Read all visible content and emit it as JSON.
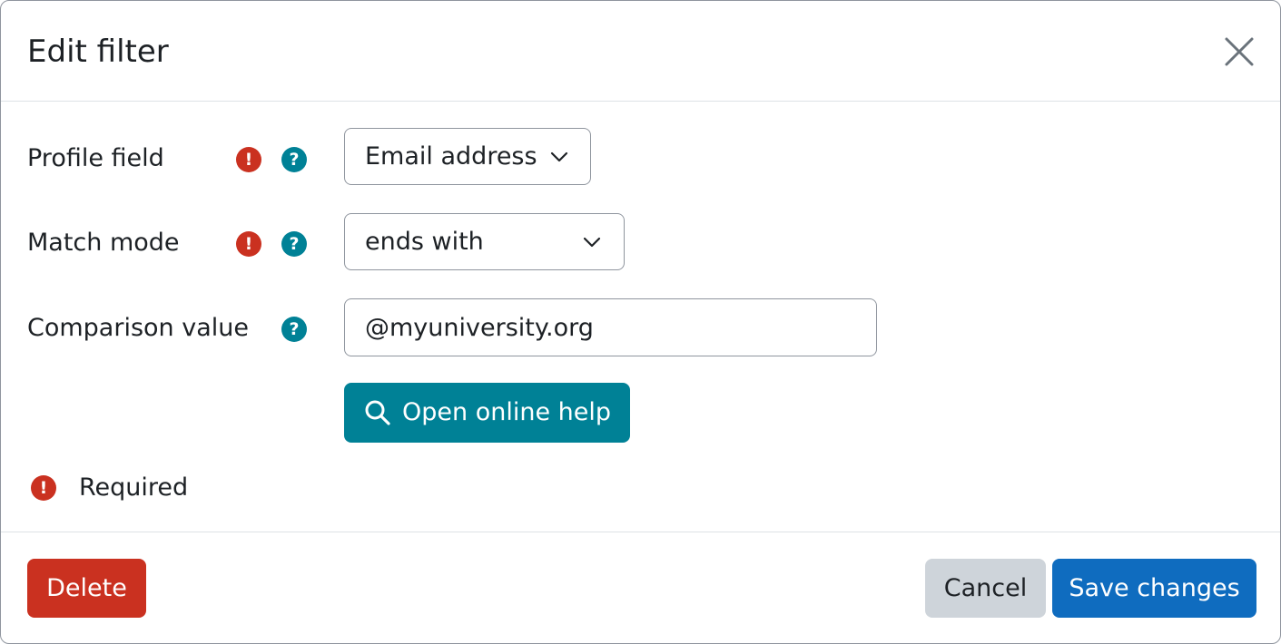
{
  "dialog": {
    "title": "Edit filter"
  },
  "form": {
    "profile_field": {
      "label": "Profile field",
      "value": "Email address"
    },
    "match_mode": {
      "label": "Match mode",
      "value": "ends with"
    },
    "comparison_value": {
      "label": "Comparison value",
      "value": "@myuniversity.org"
    },
    "help_button_label": "Open online help",
    "required_note": "Required"
  },
  "footer": {
    "delete_label": "Delete",
    "cancel_label": "Cancel",
    "save_label": "Save changes"
  },
  "icons": {
    "required": "exclamation-circle-icon",
    "help": "question-circle-icon",
    "close": "close-icon",
    "search": "search-icon",
    "chevron": "chevron-down-icon"
  },
  "colors": {
    "danger": "#ca3120",
    "info": "#008196",
    "primary": "#0f6cbf",
    "secondary": "#ced4da"
  }
}
